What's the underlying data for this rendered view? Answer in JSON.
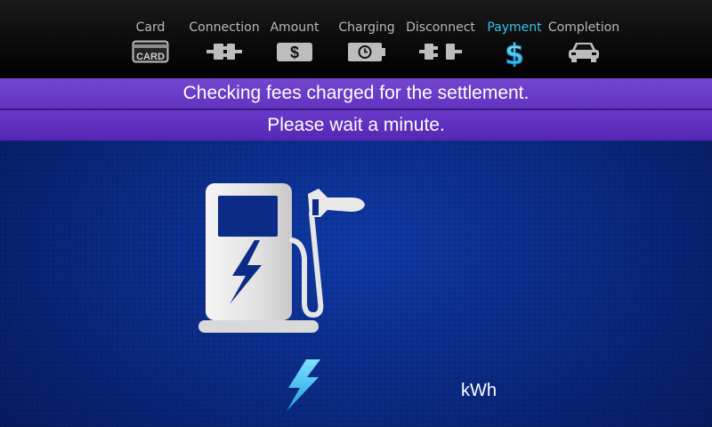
{
  "steps": [
    {
      "label": "Card",
      "icon": "card-icon"
    },
    {
      "label": "Connection",
      "icon": "plug-connect-icon"
    },
    {
      "label": "Amount",
      "icon": "dollar-bill-icon"
    },
    {
      "label": "Charging",
      "icon": "battery-clock-icon"
    },
    {
      "label": "Disconnect",
      "icon": "plug-disconnect-icon"
    },
    {
      "label": "Payment",
      "icon": "dollar-sign-icon"
    },
    {
      "label": "Completion",
      "icon": "car-icon"
    }
  ],
  "card_icon_text": "CARD",
  "active_step": "Payment",
  "message": {
    "line1": "Checking fees charged for the settlement.",
    "line2": "Please wait a minute."
  },
  "energy": {
    "value": "",
    "unit": "kWh"
  },
  "colors": {
    "active_step": "#35c2f0",
    "inactive_step": "#b9b9b9",
    "banner": "#6a39c8",
    "background": "#0b2b86",
    "bolt": "#2fb8f0"
  }
}
